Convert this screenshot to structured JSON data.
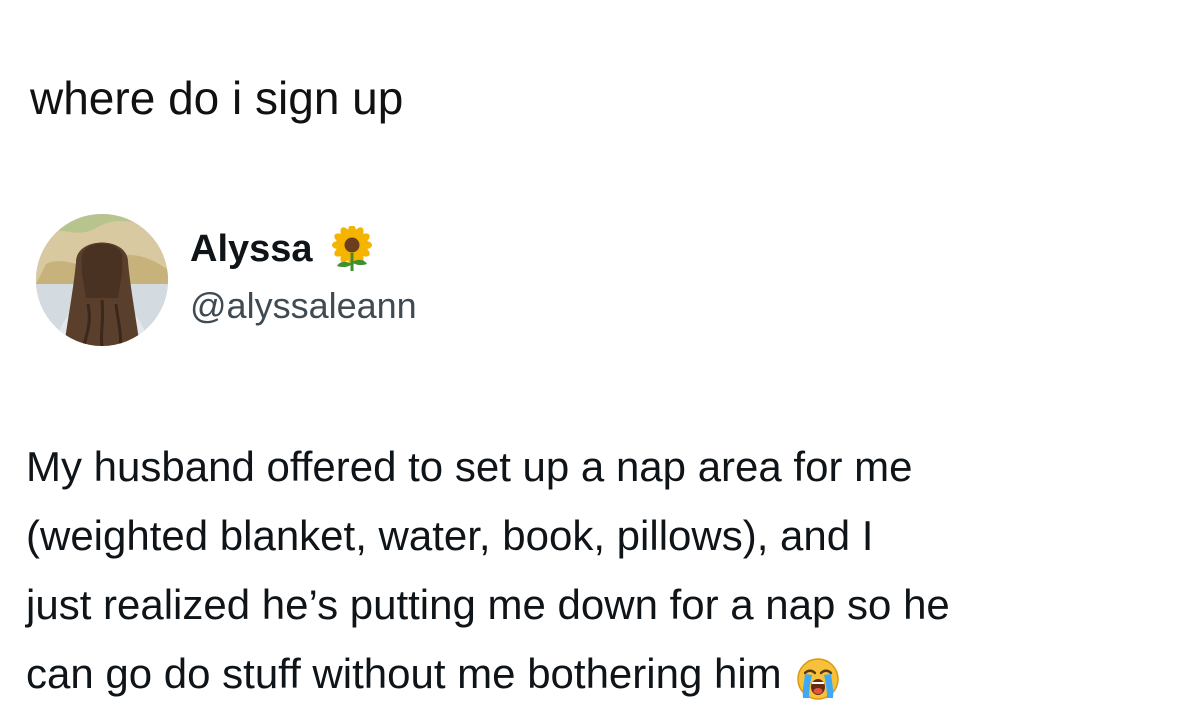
{
  "caption": "where do i sign up",
  "tweet": {
    "author": {
      "display_name": "Alyssa",
      "name_emoji": "sunflower-icon",
      "handle": "@alyssaleann"
    },
    "body_lines": [
      "My husband offered to set up a nap area for me",
      "(weighted blanket, water, book, pillows), and I",
      "just realized he’s putting me down for a nap so he",
      "can go do stuff without me bothering him"
    ],
    "trailing_emoji": "loudly-crying-face-icon"
  }
}
